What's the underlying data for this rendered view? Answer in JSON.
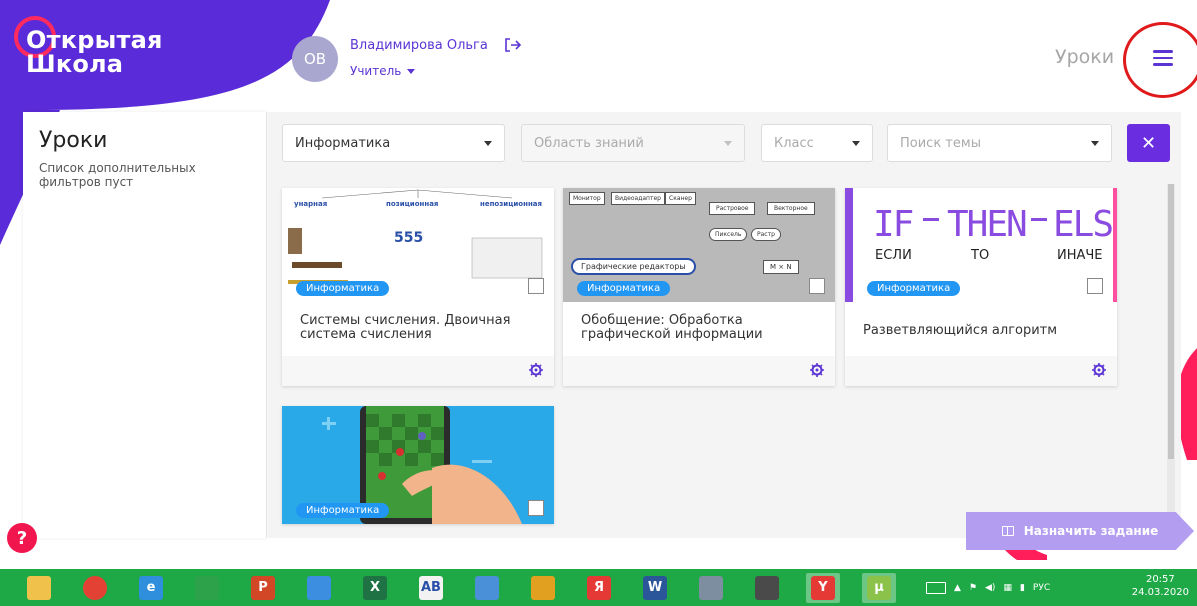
{
  "brand": {
    "line1": "Открытая",
    "line2": "Школа"
  },
  "user": {
    "initials": "ОВ",
    "name": "Владимирова Ольга",
    "role": "Учитель"
  },
  "header": {
    "title": "Уроки"
  },
  "sidebar": {
    "title": "Уроки",
    "subtitle": "Список дополнительных фильтров пуст"
  },
  "filters": {
    "subject": "Информатика",
    "area_placeholder": "Область знаний",
    "grade_placeholder": "Класс",
    "topic_placeholder": "Поиск темы"
  },
  "cards": [
    {
      "title": "Системы счисления. Двоичная система счисления",
      "tag": "Информатика",
      "thumb_labels": [
        "унарная",
        "позиционная",
        "непозиционная",
        "555"
      ]
    },
    {
      "title": "Обобщение: Обработка графической информации",
      "tag": "Информатика",
      "thumb_labels": [
        "Монитор",
        "Видеоадаптер",
        "Сканер",
        "Растровое",
        "Векторное",
        "Пиксель",
        "Растр",
        "Графические редакторы",
        "M × N"
      ]
    },
    {
      "title": "Разветвляющийся алгоритм",
      "tag": "Информатика",
      "thumb_labels": [
        "IF",
        "THEN",
        "ELSE",
        "ЕСЛИ",
        "ТО",
        "ИНАЧЕ"
      ]
    },
    {
      "title": "",
      "tag": "Информатика",
      "thumb_labels": []
    }
  ],
  "actions": {
    "assign": "Назначить задание",
    "help": "?"
  },
  "taskbar": {
    "apps": [
      {
        "name": "explorer",
        "label": "",
        "color": "#f0c24b"
      },
      {
        "name": "chrome",
        "label": "",
        "color": "#e34133"
      },
      {
        "name": "ie",
        "label": "e",
        "color": "#2f8fdc"
      },
      {
        "name": "store",
        "label": "",
        "color": "#2ea24a"
      },
      {
        "name": "powerpoint",
        "label": "P",
        "color": "#d24726"
      },
      {
        "name": "settings",
        "label": "",
        "color": "#3b8ee0"
      },
      {
        "name": "excel",
        "label": "X",
        "color": "#1f7244"
      },
      {
        "name": "abnet",
        "label": "AB",
        "color": "#f2f2f2"
      },
      {
        "name": "paint",
        "label": "",
        "color": "#4a90d9"
      },
      {
        "name": "game",
        "label": "",
        "color": "#e2a020"
      },
      {
        "name": "yandex-browser",
        "label": "Я",
        "color": "#e53935"
      },
      {
        "name": "word",
        "label": "W",
        "color": "#2b579a"
      },
      {
        "name": "calculator",
        "label": "",
        "color": "#7c8ea0"
      },
      {
        "name": "microphone",
        "label": "",
        "color": "#4a4a4a"
      },
      {
        "name": "yandex",
        "label": "Y",
        "color": "#e53935"
      },
      {
        "name": "utorrent",
        "label": "µ",
        "color": "#8bc34a"
      }
    ],
    "lang": "РУС",
    "time": "20:57",
    "date": "24.03.2020"
  }
}
